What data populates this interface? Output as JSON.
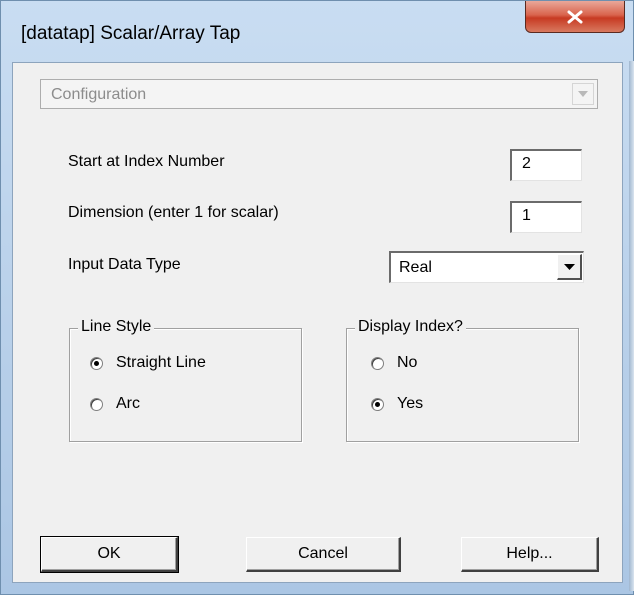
{
  "window": {
    "title": "[datatap] Scalar/Array Tap",
    "close_icon": "close-x-icon"
  },
  "config": {
    "value": "Configuration",
    "disabled": true
  },
  "fields": {
    "start_index_label": "Start at Index Number",
    "start_index_value": "2",
    "dimension_label": "Dimension (enter 1 for scalar)",
    "dimension_value": "1",
    "data_type_label": "Input Data Type",
    "data_type_value": "Real"
  },
  "line_style": {
    "legend": "Line Style",
    "options": [
      "Straight Line",
      "Arc"
    ],
    "selected": "Straight Line"
  },
  "display_index": {
    "legend": "Display Index?",
    "options": [
      "No",
      "Yes"
    ],
    "selected": "Yes"
  },
  "buttons": {
    "ok": "OK",
    "cancel": "Cancel",
    "help": "Help..."
  },
  "colors": {
    "frame": "#b7cfe9",
    "close_button": "#c73a22",
    "client": "#f0f0f0"
  }
}
